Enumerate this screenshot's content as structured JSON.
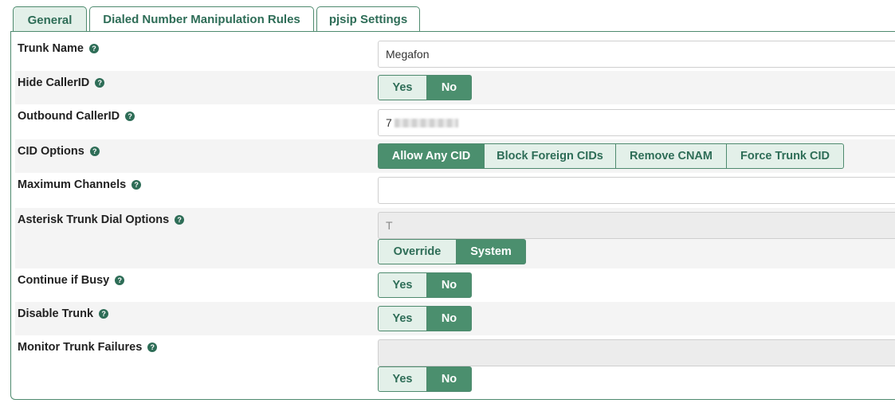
{
  "tabs": [
    {
      "label": "General",
      "active": true
    },
    {
      "label": "Dialed Number Manipulation Rules",
      "active": false
    },
    {
      "label": "pjsip Settings",
      "active": false
    }
  ],
  "help_glyph": "?",
  "fields": {
    "trunk_name": {
      "label": "Trunk Name",
      "value": "Megafon"
    },
    "hide_callerid": {
      "label": "Hide CallerID",
      "options": [
        "Yes",
        "No"
      ],
      "selected": "No"
    },
    "outbound_callerid": {
      "label": "Outbound CallerID",
      "value": "7"
    },
    "cid_options": {
      "label": "CID Options",
      "options": [
        "Allow Any CID",
        "Block Foreign CIDs",
        "Remove CNAM",
        "Force Trunk CID"
      ],
      "selected": "Allow Any CID"
    },
    "max_channels": {
      "label": "Maximum Channels",
      "value": ""
    },
    "dial_options": {
      "label": "Asterisk Trunk Dial Options",
      "value": "T",
      "options": [
        "Override",
        "System"
      ],
      "selected": "System"
    },
    "continue_busy": {
      "label": "Continue if Busy",
      "options": [
        "Yes",
        "No"
      ],
      "selected": "No"
    },
    "disable_trunk": {
      "label": "Disable Trunk",
      "options": [
        "Yes",
        "No"
      ],
      "selected": "No"
    },
    "monitor_failures": {
      "label": "Monitor Trunk Failures",
      "value": "",
      "options": [
        "Yes",
        "No"
      ],
      "selected": "No"
    }
  },
  "colors": {
    "accent": "#4b8f6e",
    "accent_light": "#e3f0e9",
    "text_accent": "#2e6d57"
  }
}
